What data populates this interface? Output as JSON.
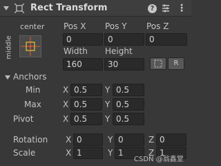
{
  "header": {
    "title": "Rect Transform"
  },
  "anchor_widget": {
    "top_label": "center",
    "side_label": "middle"
  },
  "columns": {
    "pos_x": "Pos X",
    "pos_y": "Pos Y",
    "pos_z": "Pos Z",
    "width": "Width",
    "height": "Height"
  },
  "values": {
    "pos_x": "0",
    "pos_y": "0",
    "pos_z": "0",
    "width": "160",
    "height": "30"
  },
  "buttons": {
    "blueprint": "",
    "raw": "R"
  },
  "anchors": {
    "label": "Anchors",
    "min": {
      "label": "Min",
      "x_label": "X",
      "x": "0.5",
      "y_label": "Y",
      "y": "0.5"
    },
    "max": {
      "label": "Max",
      "x_label": "X",
      "x": "0.5",
      "y_label": "Y",
      "y": "0.5"
    }
  },
  "pivot": {
    "label": "Pivot",
    "x_label": "X",
    "x": "0.5",
    "y_label": "Y",
    "y": "0.5"
  },
  "rotation": {
    "label": "Rotation",
    "x_label": "X",
    "x": "0",
    "y_label": "Y",
    "y": "0",
    "z_label": "Z",
    "z": "0"
  },
  "scale": {
    "label": "Scale",
    "x_label": "X",
    "x": "1",
    "y_label": "Y",
    "y": "1",
    "z_label": "Z",
    "z": "1"
  },
  "watermark": "CSDN @翁鑫堂",
  "colors": {
    "panel": "#383838",
    "field": "#2a2a2a",
    "anchor_red": "#e05a3a",
    "anchor_yellow": "#f0c030"
  }
}
